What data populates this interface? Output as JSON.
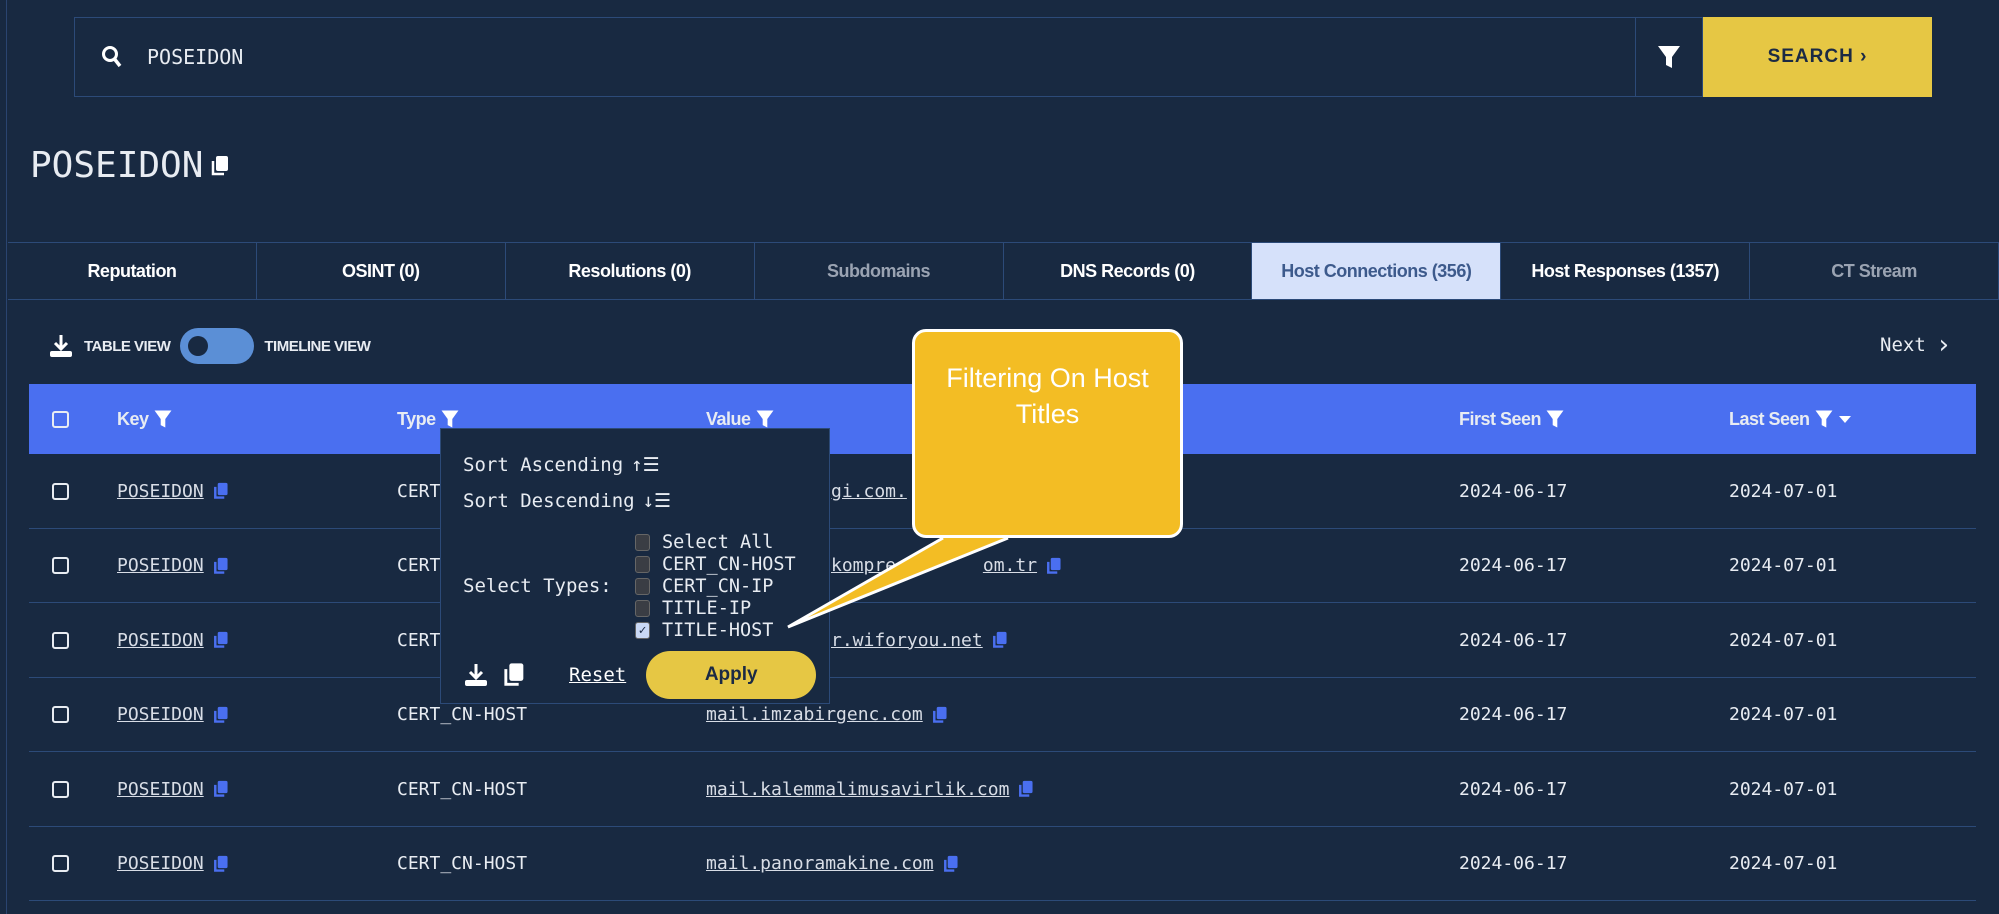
{
  "search": {
    "value": "POSEIDON",
    "button": "SEARCH ›"
  },
  "title": "POSEIDON",
  "tabs": [
    {
      "label": "Reputation"
    },
    {
      "label": "OSINT (0)"
    },
    {
      "label": "Resolutions (0)"
    },
    {
      "label": "Subdomains"
    },
    {
      "label": "DNS Records (0)"
    },
    {
      "label": "Host Connections (356)"
    },
    {
      "label": "Host Responses (1357)"
    },
    {
      "label": "CT Stream"
    }
  ],
  "toolbar": {
    "table_view": "TABLE VIEW",
    "timeline_view": "TIMELINE VIEW",
    "next": "Next",
    "next_icon": "›"
  },
  "table": {
    "headers": {
      "key": "Key",
      "type": "Type",
      "value": "Value",
      "first_seen": "First Seen",
      "last_seen": "Last Seen"
    },
    "rows": [
      {
        "key": "POSEIDON",
        "type": "CERT",
        "value": "gi.com.",
        "first_seen": "2024-06-17",
        "last_seen": "2024-07-01"
      },
      {
        "key": "POSEIDON",
        "type": "CERT",
        "value": "kompres",
        "value2": "om.tr",
        "first_seen": "2024-06-17",
        "last_seen": "2024-07-01"
      },
      {
        "key": "POSEIDON",
        "type": "CERT",
        "value": "r.wiforyou.net",
        "first_seen": "2024-06-17",
        "last_seen": "2024-07-01"
      },
      {
        "key": "POSEIDON",
        "type": "CERT_CN-HOST",
        "value": "mail.imzabirgenc.com",
        "first_seen": "2024-06-17",
        "last_seen": "2024-07-01"
      },
      {
        "key": "POSEIDON",
        "type": "CERT_CN-HOST",
        "value": "mail.kalemmalimusavirlik.com",
        "first_seen": "2024-06-17",
        "last_seen": "2024-07-01"
      },
      {
        "key": "POSEIDON",
        "type": "CERT_CN-HOST",
        "value": "mail.panoramakine.com",
        "first_seen": "2024-06-17",
        "last_seen": "2024-07-01"
      }
    ]
  },
  "popover": {
    "sort_asc": "Sort Ascending",
    "sort_desc": "Sort Descending",
    "select_types": "Select Types:",
    "options": [
      {
        "label": "Select All",
        "checked": false
      },
      {
        "label": "CERT_CN-HOST",
        "checked": false
      },
      {
        "label": "CERT_CN-IP",
        "checked": false
      },
      {
        "label": "TITLE-IP",
        "checked": false
      },
      {
        "label": "TITLE-HOST",
        "checked": true
      }
    ],
    "reset": "Reset",
    "apply": "Apply"
  },
  "callout": {
    "text": "Filtering On Host Titles"
  },
  "colors": {
    "background": "#182941",
    "header": "#4a6ff0",
    "accent_yellow": "#e6c744",
    "callout": "#f3bd24",
    "active_tab": "#d6e1fa",
    "copy_icon": "#4a6ff0"
  }
}
